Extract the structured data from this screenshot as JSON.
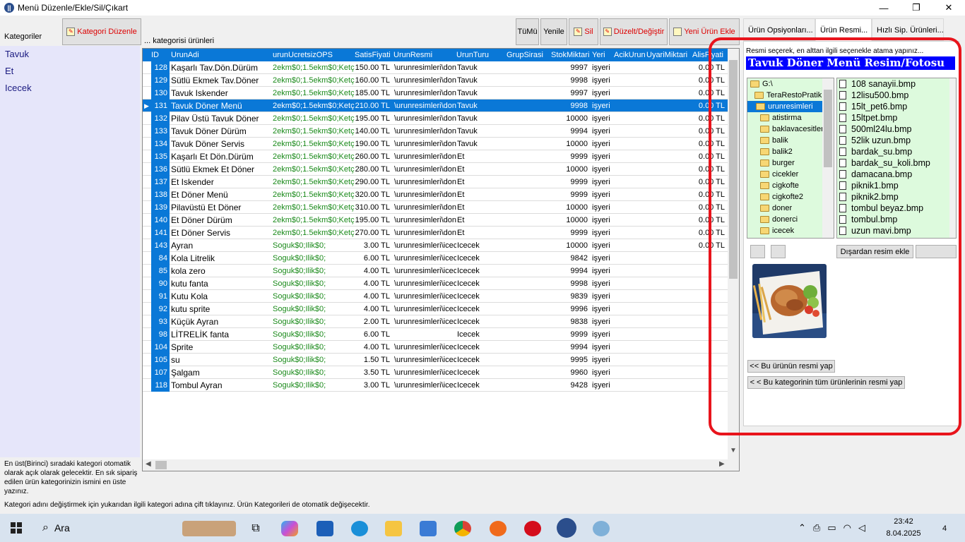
{
  "window": {
    "title": "Menü Düzenle/Ekle/Sil/Çıkart",
    "min": "—",
    "max": "❐",
    "close": "✕"
  },
  "left": {
    "label": "Kategoriler",
    "category_button": "Kategori Düzenle",
    "categories": [
      "Tavuk",
      "Et",
      "Icecek"
    ],
    "info": "En üst(Birinci) sıradaki kategori otomatik olarak açık olarak gelecektir. En sık sipariş edilen ürün kategorinizin ismini en üste yazınız.",
    "hint": "Kategori adını değiştirmek için yukarıdan ilgili kategori adına çift tıklayınız. Ürün Kategorileri de otomatik değişecektir."
  },
  "toolbar": {
    "grid_label": "... kategorisi ürünleri",
    "all": "TüMü",
    "refresh": "Yenile",
    "delete": "Sil",
    "edit": "Düzelt/Değiştir",
    "add": "Yeni Ürün Ekle"
  },
  "grid": {
    "columns": [
      "ID",
      "UrunAdi",
      "urunUcretsizOPS",
      "SatisFiyati",
      "UrunResmi",
      "UrunTuru",
      "GrupSirasi",
      "StokMiktari",
      "Yeri",
      "AcikUrun",
      "UyariMiktari",
      "AlisFiyati"
    ],
    "selected_row_id": "131",
    "rows": [
      {
        "id": "128",
        "name": "Kaşarlı Tav.Dön.Dürüm",
        "ops": "2ekm$0;1.5ekm$0;Ketç",
        "price": "150.00 TL",
        "img": "\\urunresimleri\\don",
        "type": "Tavuk",
        "stock": "9997",
        "place": "işyeri",
        "alis": "0.00 TL"
      },
      {
        "id": "129",
        "name": "Sütlü Ekmek Tav.Döner",
        "ops": "2ekm$0;1.5ekm$0;Ketç",
        "price": "160.00 TL",
        "img": "\\urunresimleri\\don",
        "type": "Tavuk",
        "stock": "9998",
        "place": "işyeri",
        "alis": "0.00 TL"
      },
      {
        "id": "130",
        "name": "Tavuk Iskender",
        "ops": "2ekm$0;1.5ekm$0;Ketç",
        "price": "185.00 TL",
        "img": "\\urunresimleri\\don",
        "type": "Tavuk",
        "stock": "9997",
        "place": "işyeri",
        "alis": "0.00 TL"
      },
      {
        "id": "131",
        "name": "Tavuk Döner Menü",
        "ops": "2ekm$0;1.5ekm$0;Ketç",
        "price": "210.00 TL",
        "img": "\\urunresimleri\\don",
        "type": "Tavuk",
        "stock": "9998",
        "place": "işyeri",
        "alis": "0.00 TL"
      },
      {
        "id": "132",
        "name": "Pilav Üstü Tavuk Döner",
        "ops": "2ekm$0;1.5ekm$0;Ketç",
        "price": "195.00 TL",
        "img": "\\urunresimleri\\don",
        "type": "Tavuk",
        "stock": "10000",
        "place": "işyeri",
        "alis": "0.00 TL"
      },
      {
        "id": "133",
        "name": "Tavuk Döner Dürüm",
        "ops": "2ekm$0;1.5ekm$0;Ketç",
        "price": "140.00 TL",
        "img": "\\urunresimleri\\don",
        "type": "Tavuk",
        "stock": "9994",
        "place": "işyeri",
        "alis": "0.00 TL"
      },
      {
        "id": "134",
        "name": "Tavuk Döner Servis",
        "ops": "2ekm$0;1.5ekm$0;Ketç",
        "price": "190.00 TL",
        "img": "\\urunresimleri\\don",
        "type": "Tavuk",
        "stock": "10000",
        "place": "işyeri",
        "alis": "0.00 TL"
      },
      {
        "id": "135",
        "name": "Kaşarlı Et Dön.Dürüm",
        "ops": "2ekm$0;1.5ekm$0;Ketç",
        "price": "260.00 TL",
        "img": "\\urunresimleri\\don",
        "type": "Et",
        "stock": "9999",
        "place": "işyeri",
        "alis": "0.00 TL"
      },
      {
        "id": "136",
        "name": "Sütlü Ekmek Et Döner",
        "ops": "2ekm$0;1.5ekm$0;Ketç",
        "price": "280.00 TL",
        "img": "\\urunresimleri\\don",
        "type": "Et",
        "stock": "10000",
        "place": "işyeri",
        "alis": "0.00 TL"
      },
      {
        "id": "137",
        "name": "Et Iskender",
        "ops": "2ekm$0;1.5ekm$0;Ketç",
        "price": "290.00 TL",
        "img": "\\urunresimleri\\don",
        "type": "Et",
        "stock": "9999",
        "place": "işyeri",
        "alis": "0.00 TL"
      },
      {
        "id": "138",
        "name": "Et Döner Menü",
        "ops": "2ekm$0;1.5ekm$0;Ketç",
        "price": "320.00 TL",
        "img": "\\urunresimleri\\don",
        "type": "Et",
        "stock": "9999",
        "place": "işyeri",
        "alis": "0.00 TL"
      },
      {
        "id": "139",
        "name": "Pilavüstü Et Döner",
        "ops": "2ekm$0;1.5ekm$0;Ketç",
        "price": "310.00 TL",
        "img": "\\urunresimleri\\don",
        "type": "Et",
        "stock": "10000",
        "place": "işyeri",
        "alis": "0.00 TL"
      },
      {
        "id": "140",
        "name": "Et Döner Dürüm",
        "ops": "2ekm$0;1.5ekm$0;Ketç",
        "price": "195.00 TL",
        "img": "\\urunresimleri\\don",
        "type": "Et",
        "stock": "10000",
        "place": "işyeri",
        "alis": "0.00 TL"
      },
      {
        "id": "141",
        "name": "Et Döner Servis",
        "ops": "2ekm$0;1.5ekm$0;Ketç",
        "price": "270.00 TL",
        "img": "\\urunresimleri\\don",
        "type": "Et",
        "stock": "9999",
        "place": "işyeri",
        "alis": "0.00 TL"
      },
      {
        "id": "143",
        "name": "Ayran",
        "ops": "Soguk$0;Ilik$0;",
        "price": "3.00 TL",
        "img": "\\urunresimleri\\icec",
        "type": "Icecek",
        "stock": "10000",
        "place": "işyeri",
        "alis": "0.00 TL"
      },
      {
        "id": "84",
        "name": "Kola Litrelik",
        "ops": "Soguk$0;Ilik$0;",
        "price": "6.00 TL",
        "img": "\\urunresimleri\\icec",
        "type": "Icecek",
        "stock": "9842",
        "place": "işyeri",
        "alis": ""
      },
      {
        "id": "85",
        "name": "kola zero",
        "ops": "Soguk$0;Ilik$0;",
        "price": "4.00 TL",
        "img": "\\urunresimleri\\icec",
        "type": "Icecek",
        "stock": "9994",
        "place": "işyeri",
        "alis": ""
      },
      {
        "id": "90",
        "name": "kutu fanta",
        "ops": "Soguk$0;Ilik$0;",
        "price": "4.00 TL",
        "img": "\\urunresimleri\\icec",
        "type": "Icecek",
        "stock": "9998",
        "place": "işyeri",
        "alis": ""
      },
      {
        "id": "91",
        "name": "Kutu Kola",
        "ops": "Soguk$0;Ilik$0;",
        "price": "4.00 TL",
        "img": "\\urunresimleri\\icec",
        "type": "Icecek",
        "stock": "9839",
        "place": "işyeri",
        "alis": ""
      },
      {
        "id": "92",
        "name": "kutu sprite",
        "ops": "Soguk$0;Ilik$0;",
        "price": "4.00 TL",
        "img": "\\urunresimleri\\icec",
        "type": "Icecek",
        "stock": "9996",
        "place": "işyeri",
        "alis": ""
      },
      {
        "id": "93",
        "name": "Küçük Ayran",
        "ops": "Soguk$0;Ilik$0;",
        "price": "2.00 TL",
        "img": "\\urunresimleri\\icec",
        "type": "Icecek",
        "stock": "9838",
        "place": "işyeri",
        "alis": ""
      },
      {
        "id": "98",
        "name": "LİTRELİK fanta",
        "ops": "Soguk$0;Ilik$0;",
        "price": "6.00 TL",
        "img": "",
        "type": "Icecek",
        "stock": "9999",
        "place": "işyeri",
        "alis": ""
      },
      {
        "id": "104",
        "name": "Sprite",
        "ops": "Soguk$0;Ilik$0;",
        "price": "4.00 TL",
        "img": "\\urunresimleri\\icec",
        "type": "Icecek",
        "stock": "9994",
        "place": "işyeri",
        "alis": ""
      },
      {
        "id": "105",
        "name": "su",
        "ops": "Soguk$0;Ilik$0;",
        "price": "1.50 TL",
        "img": "\\urunresimleri\\icec",
        "type": "Icecek",
        "stock": "9995",
        "place": "işyeri",
        "alis": ""
      },
      {
        "id": "107",
        "name": "Şalgam",
        "ops": "Soguk$0;Ilik$0;",
        "price": "3.50 TL",
        "img": "\\urunresimleri\\icec",
        "type": "Icecek",
        "stock": "9960",
        "place": "işyeri",
        "alis": ""
      },
      {
        "id": "118",
        "name": "Tombul Ayran",
        "ops": "Soguk$0;Ilik$0;",
        "price": "3.00 TL",
        "img": "\\urunresimleri\\icec",
        "type": "Icecek",
        "stock": "9428",
        "place": "işyeri",
        "alis": ""
      }
    ]
  },
  "right": {
    "tabs": [
      "Ürün Opsiyonları...",
      "Ürün Resmi...",
      "Hızlı Sip. Ürünleri..."
    ],
    "active_tab": "Ürün Resmi...",
    "hint": "Resmi seçerek, en alttan ilgili seçenekle atama yapınız...",
    "title": "Tavuk Döner Menü Resim/Fotosu",
    "tree": [
      "G:\\",
      "TeraRestoPratik",
      "urunresimleri",
      "atistirma",
      "baklavacesitler",
      "balik",
      "balik2",
      "burger",
      "cicekler",
      "cigkofte",
      "cigkofte2",
      "doner",
      "donerci",
      "icecek"
    ],
    "tree_selected": "urunresimleri",
    "files": [
      "108 sanayii.bmp",
      "12lisu500.bmp",
      "15lt_pet6.bmp",
      "15ltpet.bmp",
      "500ml24lu.bmp",
      "52lik uzun.bmp",
      "bardak_su.bmp",
      "bardak_su_koli.bmp",
      "damacana.bmp",
      "piknik1.bmp",
      "piknik2.bmp",
      "tombul beyaz.bmp",
      "tombul.bmp",
      "uzun mavi.bmp"
    ],
    "external_button": "Dışardan resim ekle",
    "assign_product": "<< Bu ürünün resmi yap",
    "assign_category": "< < Bu kategorinin tüm ürünlerinin resmi yap"
  },
  "taskbar": {
    "search": "Ara",
    "time": "23:42",
    "date": "8.04.2025",
    "notifications": "4"
  }
}
